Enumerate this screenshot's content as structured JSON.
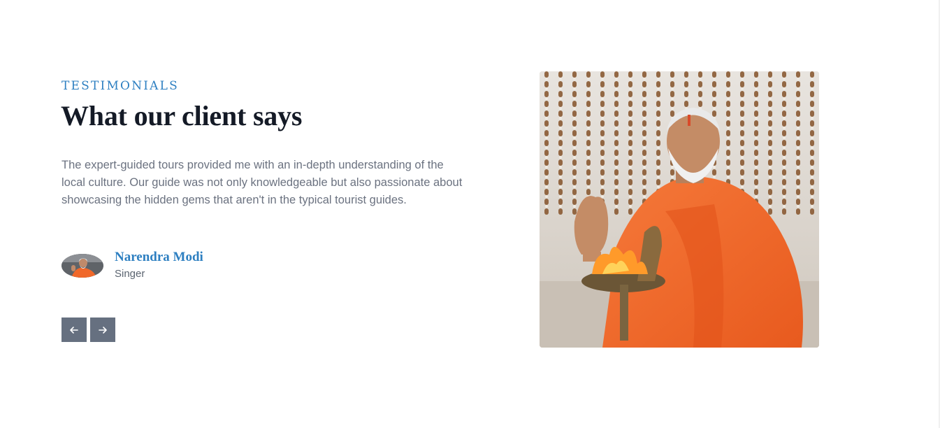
{
  "testimonials": {
    "eyebrow": "TESTIMONIALS",
    "heading": "What our client says",
    "quote": "The expert-guided tours provided me with an in-depth understanding of the local culture. Our guide was not only knowledgeable but also passionate about showcasing the hidden gems that aren't in the typical tourist guides.",
    "author": {
      "name": "Narendra Modi",
      "role": "Singer"
    },
    "controls": {
      "prev_icon": "arrow-left-icon",
      "next_icon": "arrow-right-icon"
    }
  },
  "colors": {
    "accent": "#2d7fc1",
    "heading": "#141a26",
    "body_text": "#6b7280",
    "button_bg": "#667080",
    "robe": "#f0682a"
  }
}
